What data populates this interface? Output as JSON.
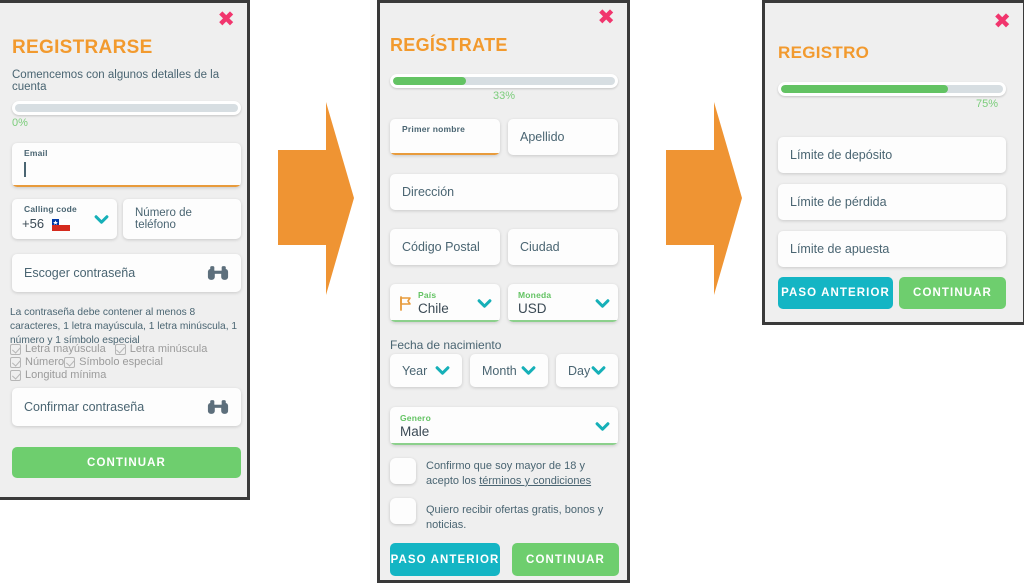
{
  "colors": {
    "accent_orange": "#f29a2e",
    "green": "#63c363",
    "teal": "#14b5c4",
    "pink_close": "#f1356d",
    "text_blue_gray": "#4a6572",
    "arrow_orange": "#ef9433",
    "panel_bg": "#efefef"
  },
  "step1": {
    "close_icon": "close-icon",
    "title": "REGISTRARSE",
    "subtitle": "Comencemos con algunos detalles de la cuenta",
    "progress": {
      "percent": 0,
      "label": "0%"
    },
    "email": {
      "label": "Email",
      "value": ""
    },
    "calling_code": {
      "label": "Calling code",
      "value": "+56",
      "flag": "chile-flag-icon"
    },
    "phone": {
      "placeholder": "Número de teléfono"
    },
    "password": {
      "placeholder": "Escoger contraseña",
      "toggle_icon": "binoculars-icon"
    },
    "rules_text": "La contraseña debe contener al menos 8 caracteres, 1 letra mayúscula, 1 letra minúscula, 1 número y 1 símbolo especial",
    "rules": [
      "Letra mayúscula",
      "Letra minúscula",
      "Número",
      "Símbolo especial",
      "Longitud mínima"
    ],
    "confirm_password": {
      "placeholder": "Confirmar contraseña",
      "toggle_icon": "binoculars-icon"
    },
    "continue_label": "CONTINUAR"
  },
  "step2": {
    "close_icon": "close-icon",
    "title": "REGÍSTRATE",
    "progress": {
      "percent": 33,
      "label": "33%"
    },
    "first_name": {
      "label": "Primer nombre",
      "value": ""
    },
    "last_name": {
      "placeholder": "Apellido"
    },
    "address": {
      "placeholder": "Dirección"
    },
    "postal_code": {
      "placeholder": "Código Postal"
    },
    "city": {
      "placeholder": "Ciudad"
    },
    "country": {
      "label": "País",
      "value": "Chile",
      "icon": "flag-icon",
      "chevron": "chevron-down-icon"
    },
    "currency": {
      "label": "Moneda",
      "value": "USD",
      "chevron": "chevron-down-icon"
    },
    "dob_label": "Fecha de nacimiento",
    "dob": {
      "year": {
        "value": "Year",
        "chevron": "chevron-down-icon"
      },
      "month": {
        "value": "Month",
        "chevron": "chevron-down-icon"
      },
      "day": {
        "value": "Day",
        "chevron": "chevron-down-icon"
      }
    },
    "gender": {
      "label": "Genero",
      "value": "Male",
      "chevron": "chevron-down-icon"
    },
    "terms": {
      "text": "Confirmo que soy mayor de 18 y acepto los ",
      "link": "términos y condiciones"
    },
    "newsletter": {
      "text": "Quiero recibir ofertas gratis, bonos y noticias."
    },
    "back_label": "PASO ANTERIOR",
    "continue_label": "CONTINUAR"
  },
  "step3": {
    "close_icon": "close-icon",
    "title": "REGISTRO",
    "progress": {
      "percent": 75,
      "label": "75%"
    },
    "deposit_limit": {
      "placeholder": "Límite de depósito"
    },
    "loss_limit": {
      "placeholder": "Límite de pérdida"
    },
    "bet_limit": {
      "placeholder": "Límite de apuesta"
    },
    "back_label": "PASO ANTERIOR",
    "continue_label": "CONTINUAR"
  },
  "arrows": [
    {
      "name": "flow-arrow-1"
    },
    {
      "name": "flow-arrow-2"
    }
  ]
}
